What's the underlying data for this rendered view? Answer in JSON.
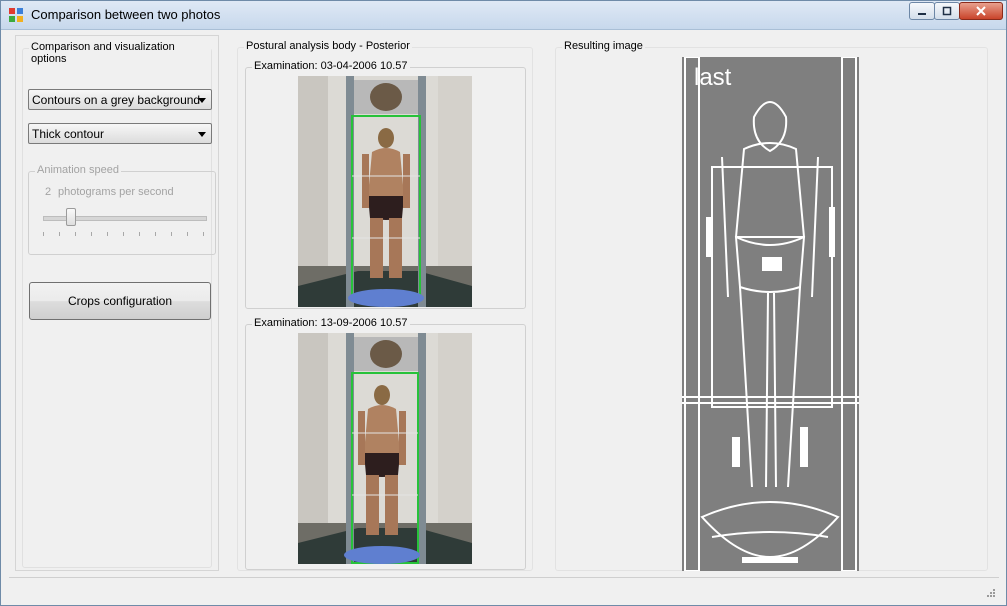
{
  "window": {
    "title": "Comparison between two photos"
  },
  "options_panel": {
    "group_title": "Comparison and visualization options",
    "background_combo": "Contours on a grey background",
    "contour_combo": "Thick contour",
    "animation": {
      "group_title": "Animation speed",
      "speed_value": "2",
      "speed_unit": "photograms per second",
      "slider_level": 0.15
    },
    "crops_button": "Crops configuration"
  },
  "postural_panel": {
    "group_title": "Postural analysis  body - Posterior",
    "exam1_label": "Examination: 03-04-2006 10.57",
    "exam2_label": "Examination: 13-09-2006 10.57"
  },
  "result_panel": {
    "group_title": "Resulting image",
    "overlay_text": "last"
  },
  "colors": {
    "window_bg": "#f0f0f0",
    "result_bg": "#7f7f7f",
    "contour": "#ffffff",
    "frame_green": "#27c23a"
  },
  "icons": [
    "app-icon",
    "minimize-icon",
    "maximize-icon",
    "close-icon",
    "dropdown-arrow-icon",
    "resize-grip-icon"
  ]
}
